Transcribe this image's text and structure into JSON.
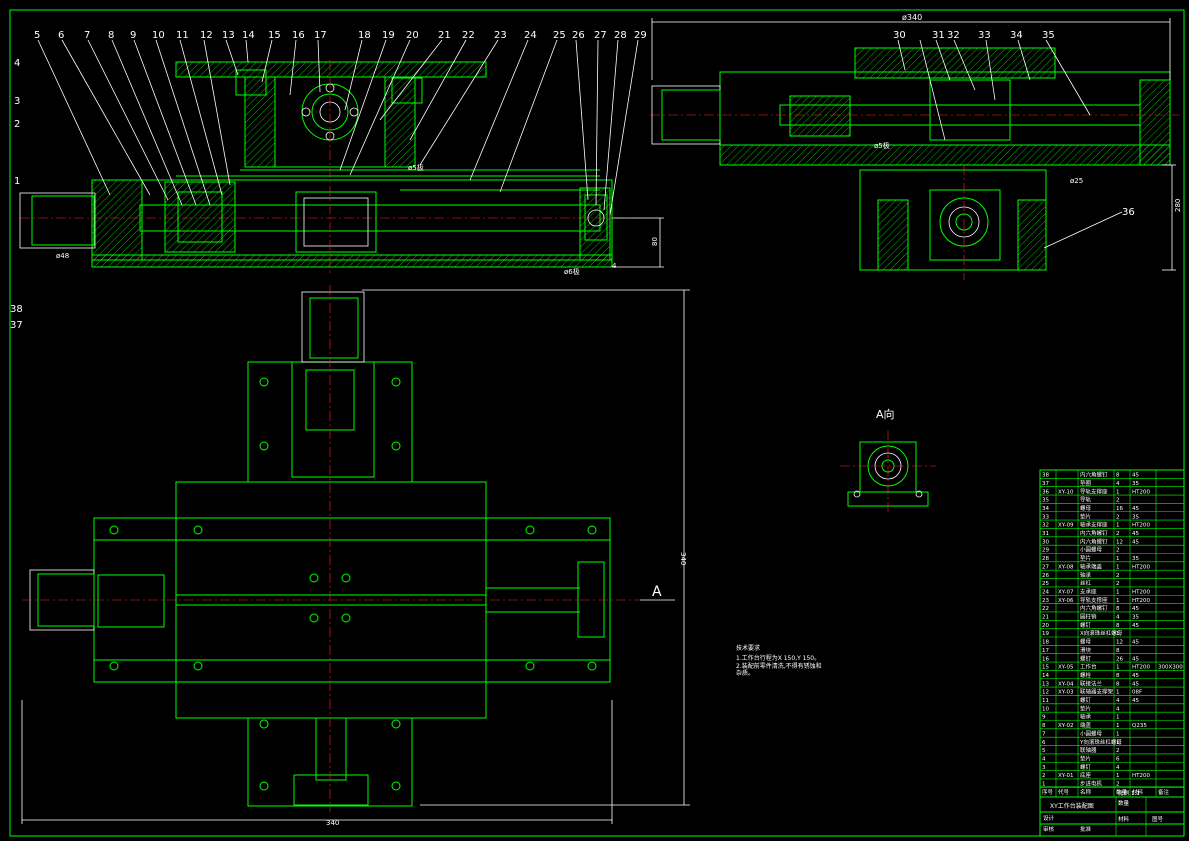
{
  "balloons_top": [
    "5",
    "6",
    "7",
    "8",
    "9",
    "10",
    "11",
    "12",
    "13",
    "14",
    "15",
    "16",
    "17",
    "18",
    "19",
    "20",
    "21",
    "22",
    "23",
    "24",
    "25",
    "26",
    "27",
    "28",
    "29"
  ],
  "balloons_left": [
    "4",
    "3",
    "2",
    "1"
  ],
  "balloons_bottom": [
    "38",
    "37"
  ],
  "balloons_side": [
    "30",
    "31",
    "32",
    "33",
    "34",
    "35"
  ],
  "balloon_36": "36",
  "dims": {
    "side_width": "ø340",
    "phi48": "ø48",
    "phi5": "ø5极",
    "phi25": "ø25",
    "phi6": "ø6极",
    "h80": "80",
    "h280": "280",
    "plan_w": "340",
    "plan_h": "340",
    "r4": "4",
    "phi5b": "ø5极"
  },
  "view_a_title": "A向",
  "section_label": "A",
  "tech_notes": {
    "title": "技术要求",
    "line1": "1.工作台行程为X 150,Y 150。",
    "line2": "2.装配前零件清洗,不得有锈蚀和",
    "line3": "杂质。"
  },
  "bom_rows": [
    [
      "38",
      "",
      "内六角螺钉",
      "8",
      "45",
      ""
    ],
    [
      "37",
      "",
      "垫圈",
      "4",
      "35",
      ""
    ],
    [
      "36",
      "XY-10",
      "导轨支撑座",
      "1",
      "HT200",
      ""
    ],
    [
      "35",
      "",
      "导轨",
      "2",
      "",
      ""
    ],
    [
      "34",
      "",
      "螺母",
      "16",
      "45",
      ""
    ],
    [
      "33",
      "",
      "垫片",
      "2",
      "35",
      ""
    ],
    [
      "32",
      "XY-09",
      "轴承支撑座",
      "1",
      "HT200",
      ""
    ],
    [
      "31",
      "",
      "内六角螺钉",
      "2",
      "45",
      ""
    ],
    [
      "30",
      "",
      "内六角螺钉",
      "12",
      "45",
      ""
    ],
    [
      "29",
      "",
      "小圆螺母",
      "2",
      "",
      ""
    ],
    [
      "28",
      "",
      "垫片",
      "1",
      "35",
      ""
    ],
    [
      "27",
      "XY-08",
      "轴承端盖",
      "1",
      "HT200",
      ""
    ],
    [
      "26",
      "",
      "轴承",
      "2",
      "",
      ""
    ],
    [
      "25",
      "",
      "丝杠",
      "2",
      "",
      ""
    ],
    [
      "24",
      "XY-07",
      "支承座",
      "1",
      "HT200",
      ""
    ],
    [
      "23",
      "XY-06",
      "导轨支撑座",
      "1",
      "HT200",
      ""
    ],
    [
      "22",
      "",
      "内六角螺钉",
      "8",
      "45",
      ""
    ],
    [
      "21",
      "",
      "圆柱销",
      "4",
      "35",
      ""
    ],
    [
      "20",
      "",
      "螺钉",
      "8",
      "45",
      ""
    ],
    [
      "19",
      "",
      "X向滚珠丝杠螺母",
      "1",
      "",
      ""
    ],
    [
      "18",
      "",
      "螺母",
      "12",
      "45",
      ""
    ],
    [
      "17",
      "",
      "滑块",
      "8",
      "",
      ""
    ],
    [
      "16",
      "",
      "螺钉",
      "26",
      "45",
      ""
    ],
    [
      "15",
      "XY-05",
      "工作台",
      "1",
      "HT200",
      "300X300"
    ],
    [
      "14",
      "",
      "螺栓",
      "8",
      "45",
      ""
    ],
    [
      "13",
      "XY-04",
      "联接法兰",
      "8",
      "45",
      ""
    ],
    [
      "12",
      "XY-03",
      "联轴器支撑架",
      "1",
      "08F",
      ""
    ],
    [
      "11",
      "",
      "螺钉",
      "4",
      "45",
      ""
    ],
    [
      "10",
      "",
      "垫片",
      "4",
      "",
      ""
    ],
    [
      "9",
      "",
      "轴承",
      "1",
      "",
      ""
    ],
    [
      "8",
      "XY-02",
      "端盖",
      "1",
      "Q235",
      ""
    ],
    [
      "7",
      "",
      "小圆螺母",
      "1",
      "",
      ""
    ],
    [
      "6",
      "",
      "Y向滚珠丝杠螺母",
      "1",
      "",
      ""
    ],
    [
      "5",
      "",
      "联轴器",
      "2",
      "",
      ""
    ],
    [
      "4",
      "",
      "垫片",
      "6",
      "",
      ""
    ],
    [
      "3",
      "",
      "螺钉",
      "4",
      "",
      ""
    ],
    [
      "2",
      "XY-01",
      "底座",
      "1",
      "HT200",
      ""
    ],
    [
      "1",
      "",
      "步进电机",
      "2",
      "",
      ""
    ]
  ],
  "bom_header": [
    "序号",
    "代号",
    "名称",
    "数量",
    "材料",
    "备注"
  ],
  "title_block": {
    "title": "XY工作台装配图",
    "scale_label": "比例",
    "scale": "1:1",
    "qty_label": "数量",
    "material_label": "材料",
    "sheet_label": "图号",
    "designer": "设计",
    "checker": "审核",
    "approver": "批准"
  }
}
